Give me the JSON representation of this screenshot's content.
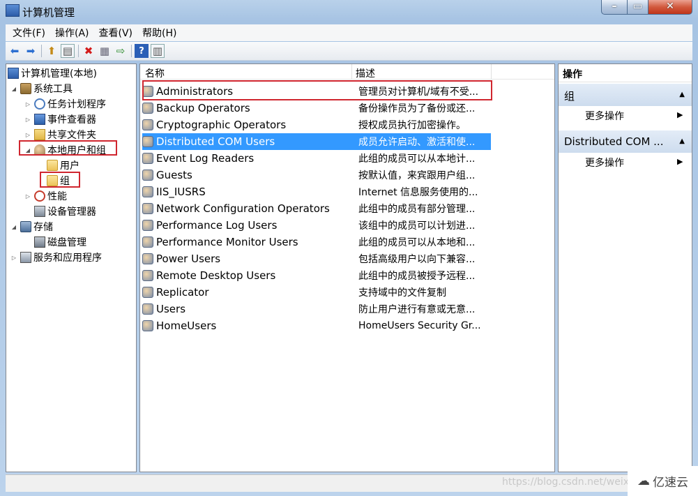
{
  "window": {
    "title": "计算机管理"
  },
  "menu": [
    "文件(F)",
    "操作(A)",
    "查看(V)",
    "帮助(H)"
  ],
  "tree": [
    {
      "label": "计算机管理(本地)",
      "icon": "computer-icon"
    },
    {
      "label": "系统工具",
      "icon": "tools-icon"
    },
    {
      "label": "任务计划程序",
      "icon": "clock-icon"
    },
    {
      "label": "事件查看器",
      "icon": "event-viewer-icon"
    },
    {
      "label": "共享文件夹",
      "icon": "shared-folder-icon"
    },
    {
      "label": "本地用户和组",
      "icon": "users-icon"
    },
    {
      "label": "用户",
      "icon": "folder-icon"
    },
    {
      "label": "组",
      "icon": "folder-icon"
    },
    {
      "label": "性能",
      "icon": "performance-icon"
    },
    {
      "label": "设备管理器",
      "icon": "device-manager-icon"
    },
    {
      "label": "存储",
      "icon": "storage-icon"
    },
    {
      "label": "磁盘管理",
      "icon": "disk-icon"
    },
    {
      "label": "服务和应用程序",
      "icon": "services-icon"
    }
  ],
  "list": {
    "columns": [
      "名称",
      "描述"
    ],
    "rows": [
      {
        "name": "Administrators",
        "desc": "管理员对计算机/域有不受..."
      },
      {
        "name": "Backup Operators",
        "desc": "备份操作员为了备份或还..."
      },
      {
        "name": "Cryptographic Operators",
        "desc": "授权成员执行加密操作。"
      },
      {
        "name": "Distributed COM Users",
        "desc": "成员允许启动、激活和使..."
      },
      {
        "name": "Event Log Readers",
        "desc": "此组的成员可以从本地计..."
      },
      {
        "name": "Guests",
        "desc": "按默认值，来宾跟用户组..."
      },
      {
        "name": "IIS_IUSRS",
        "desc": "Internet 信息服务使用的..."
      },
      {
        "name": "Network Configuration Operators",
        "desc": "此组中的成员有部分管理..."
      },
      {
        "name": "Performance Log Users",
        "desc": "该组中的成员可以计划进..."
      },
      {
        "name": "Performance Monitor Users",
        "desc": "此组的成员可以从本地和..."
      },
      {
        "name": "Power Users",
        "desc": "包括高级用户以向下兼容..."
      },
      {
        "name": "Remote Desktop Users",
        "desc": "此组中的成员被授予远程..."
      },
      {
        "name": "Replicator",
        "desc": "支持域中的文件复制"
      },
      {
        "name": "Users",
        "desc": "防止用户进行有意或无意..."
      },
      {
        "name": "HomeUsers",
        "desc": "HomeUsers Security Gr..."
      }
    ]
  },
  "actions": {
    "title": "操作",
    "groups": [
      {
        "label": "组",
        "item": "更多操作"
      },
      {
        "label": "Distributed COM ...",
        "item": "更多操作"
      }
    ]
  },
  "watermark": "https://blog.csdn.net/weixi",
  "brand": "亿速云",
  "colors": {
    "selection": "#3399ff",
    "highlight_box": "#d0262f"
  }
}
